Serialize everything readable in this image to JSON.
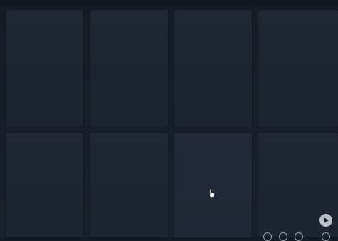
{
  "gallery": {
    "tiles": [
      {
        "row": 1,
        "col": 1
      },
      {
        "row": 1,
        "col": 2
      },
      {
        "row": 1,
        "col": 3
      },
      {
        "row": 1,
        "col": 4
      },
      {
        "row": 2,
        "col": 1
      },
      {
        "row": 2,
        "col": 2
      },
      {
        "row": 2,
        "col": 3
      },
      {
        "row": 2,
        "col": 4
      }
    ]
  },
  "controls": {
    "play_icon": "play-icon",
    "page_dots": 4
  },
  "colors": {
    "background": "#151b24",
    "tile": "#1e2732",
    "control": "#b9bec6"
  }
}
